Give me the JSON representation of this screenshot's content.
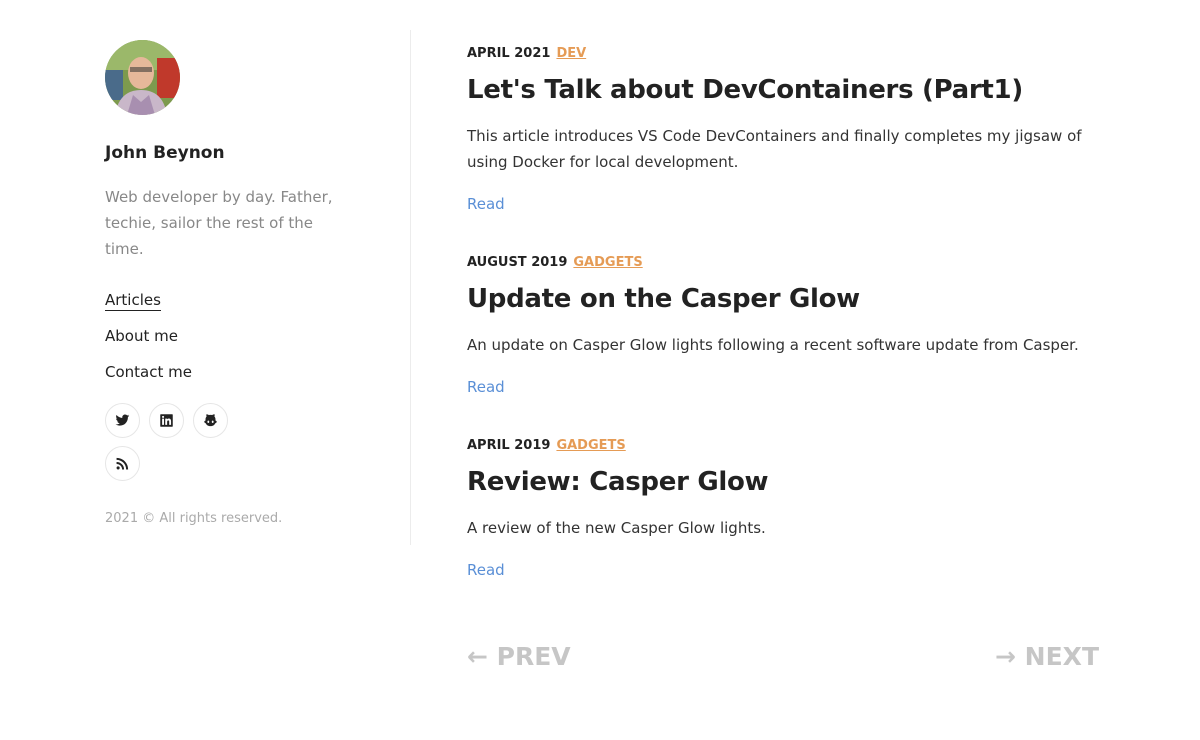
{
  "sidebar": {
    "author_name": "John Beynon",
    "bio": "Web developer by day. Father, techie, sailor the rest of the time.",
    "nav": [
      {
        "label": "Articles",
        "active": true
      },
      {
        "label": "About me",
        "active": false
      },
      {
        "label": "Contact me",
        "active": false
      }
    ],
    "social": [
      "twitter-icon",
      "linkedin-icon",
      "github-icon",
      "rss-icon"
    ],
    "copyright": "2021 © All rights reserved."
  },
  "posts": [
    {
      "date": "APRIL 2021",
      "category": "DEV",
      "title": "Let's Talk about DevContainers (Part1)",
      "excerpt": "This article introduces VS Code DevContainers and finally completes my jigsaw of using Docker for local development.",
      "read_label": "Read"
    },
    {
      "date": "AUGUST 2019",
      "category": "GADGETS",
      "title": "Update on the Casper Glow",
      "excerpt": "An update on Casper Glow lights following a recent software update from Casper.",
      "read_label": "Read"
    },
    {
      "date": "APRIL 2019",
      "category": "GADGETS",
      "title": "Review: Casper Glow",
      "excerpt": "A review of the new Casper Glow lights.",
      "read_label": "Read"
    }
  ],
  "pager": {
    "prev_label": "← PREV",
    "next_label": "→ NEXT"
  },
  "colors": {
    "category": "#e59b55",
    "link": "#5a8fd6",
    "pager": "#c6c6c6",
    "muted": "#888888"
  }
}
